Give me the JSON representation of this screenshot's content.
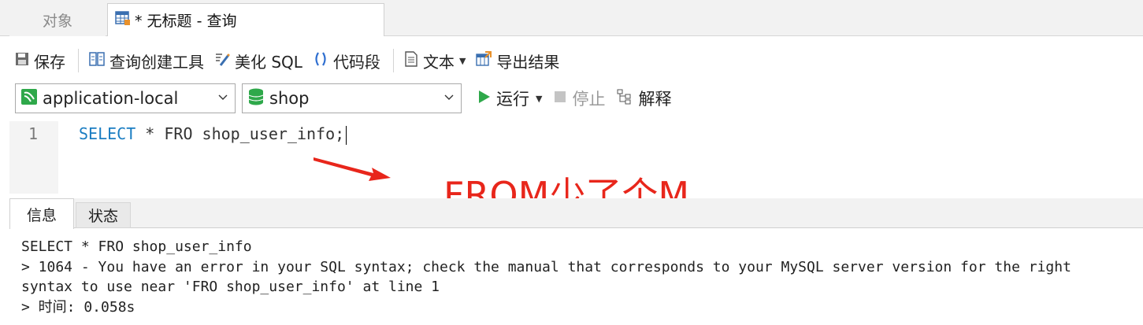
{
  "tabs": {
    "objects_label": "对象",
    "query_label": "* 无标题 - 查询"
  },
  "toolbar": {
    "save_label": "保存",
    "query_builder_label": "查询创建工具",
    "beautify_label": "美化 SQL",
    "snippet_label": "代码段",
    "text_label": "文本",
    "export_label": "导出结果"
  },
  "connection": {
    "connection_value": "application-local",
    "database_value": "shop",
    "run_label": "运行",
    "stop_label": "停止",
    "explain_label": "解释"
  },
  "editor": {
    "line_number": "1",
    "keyword": "SELECT",
    "rest": " * FRO shop_user_info;"
  },
  "annotation": {
    "text": "FROM少了个M"
  },
  "result": {
    "tabs": [
      "信息",
      "状态"
    ],
    "lines": [
      "SELECT * FRO shop_user_info",
      "> 1064 - You have an error in your SQL syntax; check the manual that corresponds to your MySQL server version for the right",
      "syntax to use near 'FRO shop_user_info' at line 1",
      "> 时间: 0.058s"
    ]
  },
  "colors": {
    "keyword": "#1a7dc2",
    "annotation": "#e8261b",
    "run_green": "#2ea84a",
    "db_green": "#2ea84a"
  }
}
